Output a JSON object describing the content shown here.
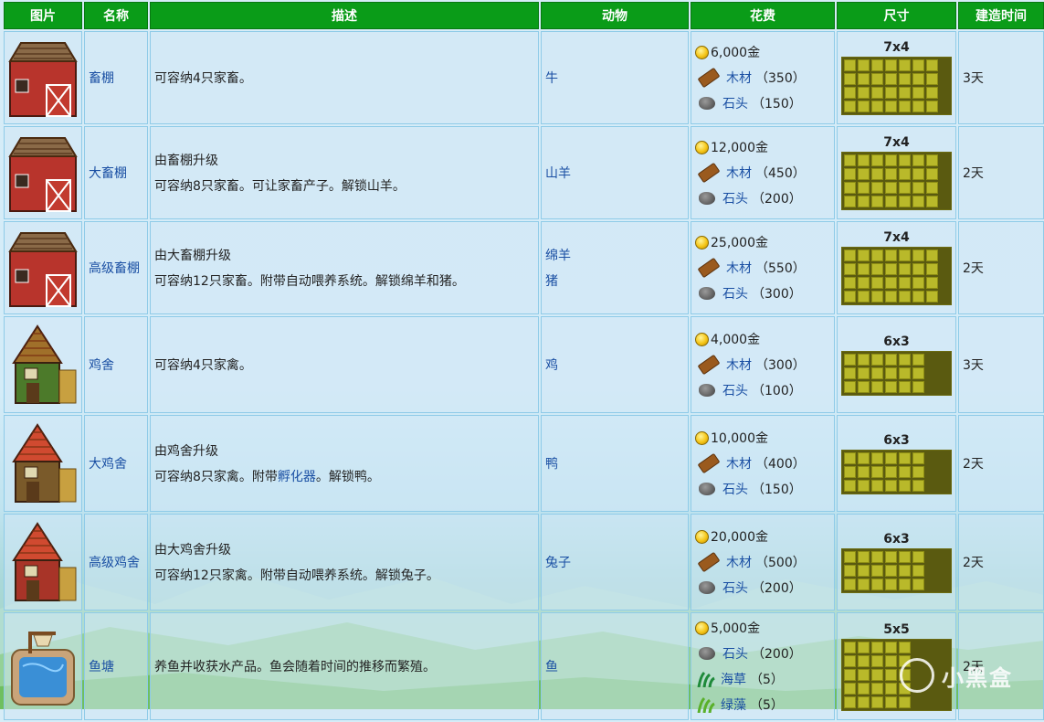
{
  "headers": [
    "图片",
    "名称",
    "描述",
    "动物",
    "花费",
    "尺寸",
    "建造时间"
  ],
  "rows": [
    {
      "name": "畜棚",
      "desc": [
        "可容纳4只家畜。"
      ],
      "animals": [
        "牛"
      ],
      "cost": {
        "gold": "6,000金",
        "items": [
          {
            "icon": "wood-icon",
            "name": "木材",
            "qty": "（350）"
          },
          {
            "icon": "stone-icon",
            "name": "石头",
            "qty": "（150）"
          }
        ]
      },
      "size": "7x4",
      "time": "3天",
      "building": "barn"
    },
    {
      "name": "大畜棚",
      "desc": [
        "由畜棚升级",
        "可容纳8只家畜。可让家畜产子。解锁山羊。"
      ],
      "animals": [
        "山羊"
      ],
      "cost": {
        "gold": "12,000金",
        "items": [
          {
            "icon": "wood-icon",
            "name": "木材",
            "qty": "（450）"
          },
          {
            "icon": "stone-icon",
            "name": "石头",
            "qty": "（200）"
          }
        ]
      },
      "size": "7x4",
      "time": "2天",
      "building": "barn"
    },
    {
      "name": "高级畜棚",
      "desc": [
        "由大畜棚升级",
        "可容纳12只家畜。附带自动喂养系统。解锁绵羊和猪。"
      ],
      "animals": [
        "绵羊",
        "猪"
      ],
      "cost": {
        "gold": "25,000金",
        "items": [
          {
            "icon": "wood-icon",
            "name": "木材",
            "qty": "（550）"
          },
          {
            "icon": "stone-icon",
            "name": "石头",
            "qty": "（300）"
          }
        ]
      },
      "size": "7x4",
      "time": "2天",
      "building": "barn"
    },
    {
      "name": "鸡舍",
      "desc": [
        "可容纳4只家禽。"
      ],
      "animals": [
        "鸡"
      ],
      "cost": {
        "gold": "4,000金",
        "items": [
          {
            "icon": "wood-icon",
            "name": "木材",
            "qty": "（300）"
          },
          {
            "icon": "stone-icon",
            "name": "石头",
            "qty": "（100）"
          }
        ]
      },
      "size": "6x3",
      "time": "3天",
      "building": "coop"
    },
    {
      "name": "大鸡舍",
      "desc": [
        "由鸡舍升级",
        "可容纳8只家禽。附带孵化器。解锁鸭。"
      ],
      "animals": [
        "鸭"
      ],
      "cost": {
        "gold": "10,000金",
        "items": [
          {
            "icon": "wood-icon",
            "name": "木材",
            "qty": "（400）"
          },
          {
            "icon": "stone-icon",
            "name": "石头",
            "qty": "（150）"
          }
        ]
      },
      "size": "6x3",
      "time": "2天",
      "building": "coop2"
    },
    {
      "name": "高级鸡舍",
      "desc": [
        "由大鸡舍升级",
        "可容纳12只家禽。附带自动喂养系统。解锁兔子。"
      ],
      "animals": [
        "兔子"
      ],
      "cost": {
        "gold": "20,000金",
        "items": [
          {
            "icon": "wood-icon",
            "name": "木材",
            "qty": "（500）"
          },
          {
            "icon": "stone-icon",
            "name": "石头",
            "qty": "（200）"
          }
        ]
      },
      "size": "6x3",
      "time": "2天",
      "building": "coop3"
    },
    {
      "name": "鱼塘",
      "desc": [
        "养鱼并收获水产品。鱼会随着时间的推移而繁殖。"
      ],
      "animals": [
        "鱼"
      ],
      "cost": {
        "gold": "5,000金",
        "items": [
          {
            "icon": "stone-icon",
            "name": "石头",
            "qty": "（200）"
          },
          {
            "icon": "seaweed-icon",
            "name": "海草",
            "qty": "（5）"
          },
          {
            "icon": "green-algae-icon",
            "name": "绿藻",
            "qty": "（5）"
          }
        ]
      },
      "size": "5x5",
      "time": "2天",
      "building": "pond"
    }
  ],
  "desc_links": {
    "row": 4,
    "line": 1,
    "text": "孵化器"
  },
  "watermark": "小黑盒",
  "colors": {
    "header_bg": "#0a9c18",
    "link": "#1a4fa3",
    "tile": "#b9b92a"
  }
}
